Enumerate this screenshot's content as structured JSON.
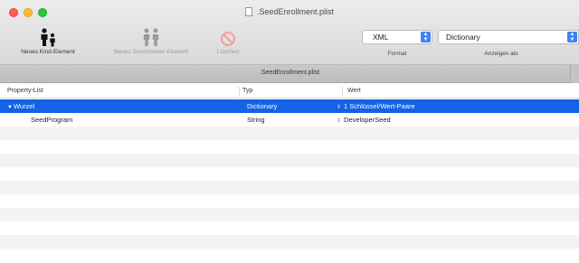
{
  "window": {
    "title": ".SeedEnrollment.plist"
  },
  "toolbar": {
    "new_child_label": "Neues Kind-Element",
    "new_sibling_label": "Neues Geschwister-Element",
    "delete_label": "Löschen",
    "format_value": "XML",
    "format_label": "Format",
    "view_value": "Dictionary",
    "view_label": "Anzeigen als"
  },
  "tab": {
    "title": ".SeedEnrollment.plist"
  },
  "table": {
    "headers": {
      "key": "Property-List",
      "type": "Typ",
      "value": "Wert"
    },
    "rows": [
      {
        "key": "Wurzel",
        "type": "Dictionary",
        "value": "1 Schlüssel/Wert-Paare"
      },
      {
        "key": "SeedProgram",
        "type": "String",
        "value": "DeveloperSeed"
      }
    ]
  },
  "colors": {
    "selection": "#1462e6",
    "accent": "#3a82f7"
  }
}
